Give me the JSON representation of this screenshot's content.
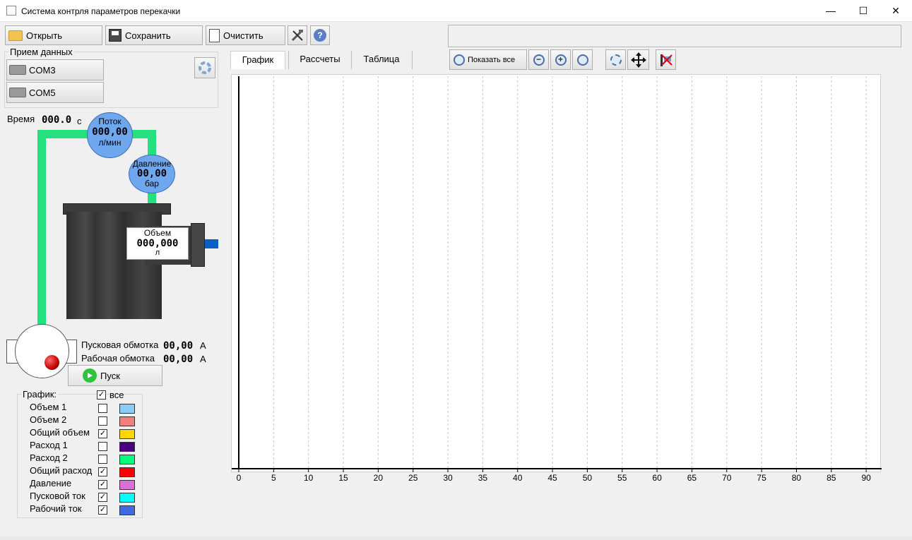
{
  "window": {
    "title": "Система контрля параметров перекачки",
    "controls": [
      "—",
      "☐",
      "✕"
    ]
  },
  "toolbar": {
    "open_label": "Открыть",
    "save_label": "Сохранить",
    "clear_label": "Очистить"
  },
  "data_receive": {
    "title": "Прием данных",
    "ports": [
      "COM3",
      "COM5"
    ]
  },
  "readouts": {
    "time_label": "Время",
    "time_value": "000.0",
    "time_unit": "с",
    "flow_label": "Поток",
    "flow_value": "000,00",
    "flow_unit": "л/мин",
    "pressure_label": "Давление",
    "pressure_value": "00,00",
    "pressure_unit": "бар",
    "volume_label": "Объем",
    "volume_value": "000,000",
    "volume_unit": "л",
    "start_winding_label": "Пусковая обмотка",
    "start_winding_value": "00,00",
    "start_winding_unit": "А",
    "work_winding_label": "Рабочая обмотка",
    "work_winding_value": "00,00",
    "work_winding_unit": "А",
    "start_button_label": "Пуск"
  },
  "tabs": [
    "График",
    "Рассчеты",
    "Таблица"
  ],
  "zoom_toolbar": {
    "show_all_label": "Показать все"
  },
  "legend": {
    "title": "График:",
    "all_label": "все",
    "all_checked": true,
    "items": [
      {
        "label": "Объем 1",
        "checked": false,
        "color": "#87cefa"
      },
      {
        "label": "Объем 2",
        "checked": false,
        "color": "#f08080"
      },
      {
        "label": "Общий объем",
        "checked": true,
        "color": "#ffd700"
      },
      {
        "label": "Расход 1",
        "checked": false,
        "color": "#4b0082"
      },
      {
        "label": "Расход 2",
        "checked": false,
        "color": "#00ff7f"
      },
      {
        "label": "Общий расход",
        "checked": true,
        "color": "#ff0000"
      },
      {
        "label": "Давление",
        "checked": true,
        "color": "#da70d6"
      },
      {
        "label": "Пусковой ток",
        "checked": true,
        "color": "#00ffff"
      },
      {
        "label": "Рабочий ток",
        "checked": true,
        "color": "#4169e1"
      }
    ]
  },
  "chart_data": {
    "type": "line",
    "title": "",
    "xlabel": "",
    "ylabel": "",
    "xlim": [
      0,
      91
    ],
    "xticks": [
      0,
      5,
      10,
      15,
      20,
      25,
      30,
      35,
      40,
      45,
      50,
      55,
      60,
      65,
      70,
      75,
      80,
      85,
      90
    ],
    "grid": true,
    "series": []
  }
}
